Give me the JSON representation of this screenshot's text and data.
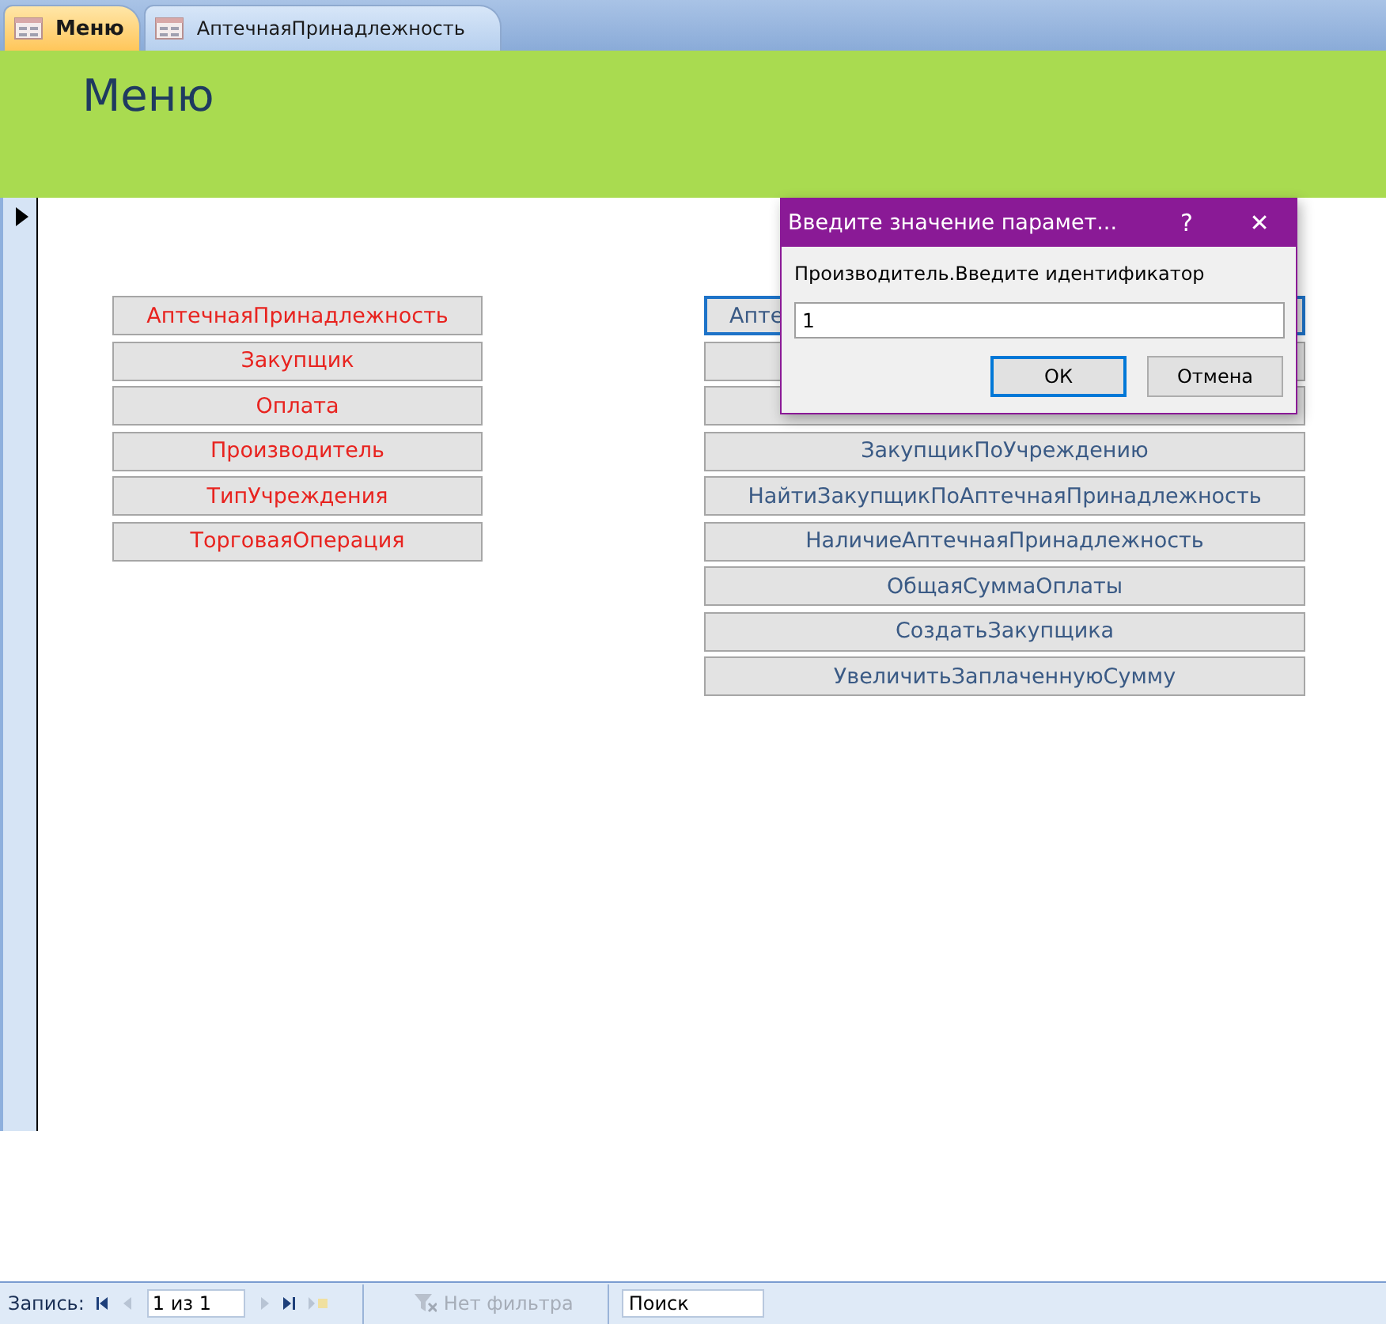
{
  "tabs": [
    {
      "label": "Меню",
      "selected": true
    },
    {
      "label": "АптечнаяПринадлежность",
      "selected": false
    }
  ],
  "form": {
    "title": "Меню",
    "left_buttons": [
      "АптечнаяПринадлежность",
      "Закупщик",
      "Оплата",
      "Производитель",
      "ТипУчреждения",
      "ТорговаяОперация"
    ],
    "right_buttons": [
      {
        "label": "Апте",
        "focused": true
      },
      {
        "focused": false
      },
      {
        "focused": false
      },
      {
        "label": "ЗакупщикПоУчреждению",
        "focused": false
      },
      {
        "label": "НайтиЗакупщикПоАптечнаяПринадлежность",
        "focused": false
      },
      {
        "label": "НаличиеАптечнаяПринадлежность",
        "focused": false
      },
      {
        "label": "ОбщаяСуммаОплаты",
        "focused": false
      },
      {
        "label": "СоздатьЗакупщика",
        "focused": false
      },
      {
        "label": "УвеличитьЗаплаченнуюСумму",
        "focused": false
      }
    ]
  },
  "dialog": {
    "title": "Введите значение парамет...",
    "help": "?",
    "close": "✕",
    "prompt": "Производитель.Введите идентификатор",
    "value": "1",
    "buttons": [
      {
        "label": "ОК",
        "default": true
      },
      {
        "label": "Отмена",
        "default": false
      }
    ]
  },
  "status_bar": {
    "record_label": "Запись:",
    "record_value": "1 из 1",
    "filter": "Нет фильтра",
    "search_placeholder": "Поиск"
  }
}
